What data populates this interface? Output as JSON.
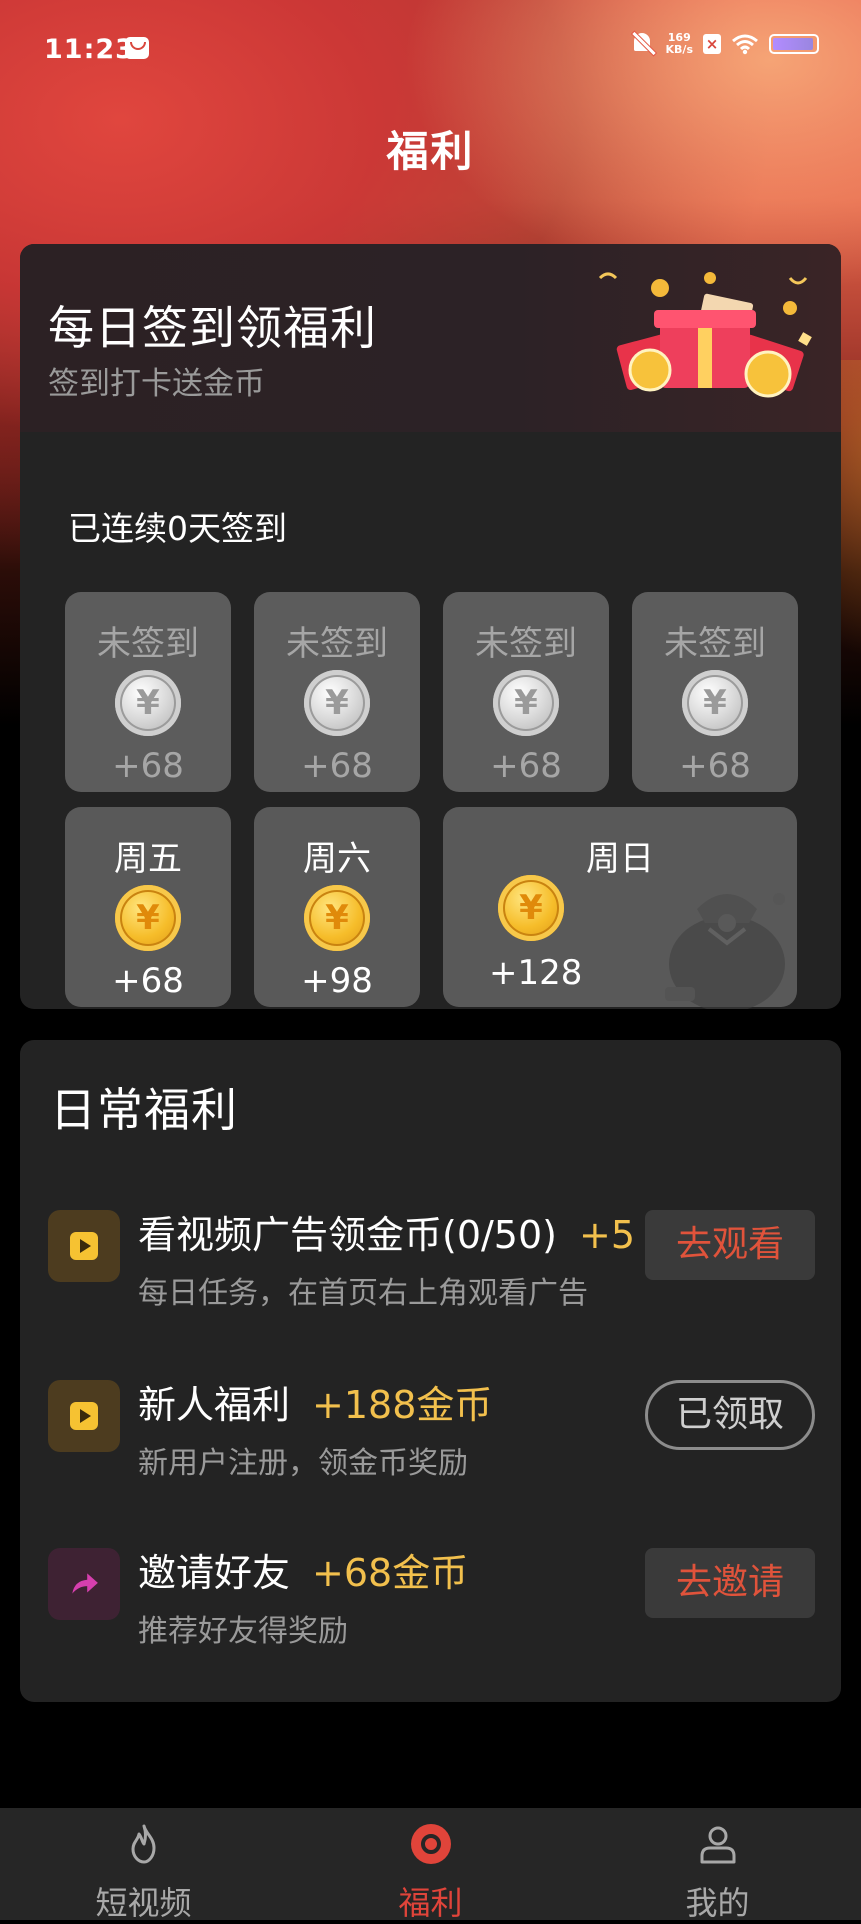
{
  "status_bar": {
    "time": "11:23",
    "speed_value": "169",
    "speed_unit": "KB/s"
  },
  "page": {
    "title": "福利"
  },
  "signin": {
    "title": "每日签到领福利",
    "subtitle": "签到打卡送金币",
    "streak_text": "已连续0天签到",
    "coin_symbol": "¥",
    "days": [
      {
        "label": "未签到",
        "amount": "+68"
      },
      {
        "label": "未签到",
        "amount": "+68"
      },
      {
        "label": "未签到",
        "amount": "+68"
      },
      {
        "label": "未签到",
        "amount": "+68"
      },
      {
        "label": "周五",
        "amount": "+68"
      },
      {
        "label": "周六",
        "amount": "+98"
      },
      {
        "label": "周日",
        "amount": "+128"
      }
    ]
  },
  "daily": {
    "title": "日常福利",
    "tasks": [
      {
        "name": "看视频广告领金币(0/50)",
        "reward": "+5",
        "desc": "每日任务，在首页右上角观看广告",
        "button": "去观看",
        "icon": "play-icon"
      },
      {
        "name": "新人福利",
        "reward": "+188金币",
        "desc": "新用户注册，领金币奖励",
        "button": "已领取",
        "icon": "play-icon"
      },
      {
        "name": "邀请好友",
        "reward": "+68金币",
        "desc": "推荐好友得奖励",
        "button": "去邀请",
        "icon": "share-icon"
      }
    ]
  },
  "nav": {
    "items": [
      {
        "label": "短视频",
        "icon": "flame-icon"
      },
      {
        "label": "福利",
        "icon": "coin-target-icon"
      },
      {
        "label": "我的",
        "icon": "person-icon"
      }
    ]
  },
  "colors": {
    "accent": "#e0443a",
    "reward_gold": "#f2c04d",
    "card_bg": "#232323"
  }
}
